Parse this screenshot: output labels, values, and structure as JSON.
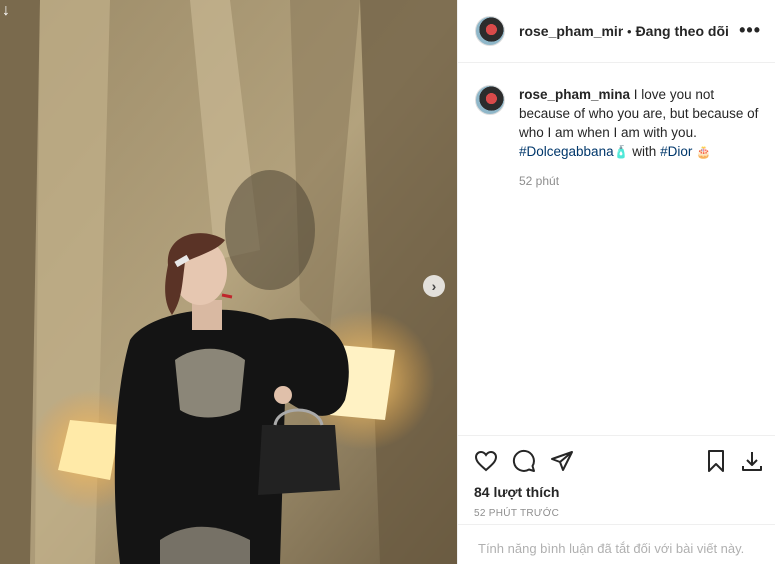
{
  "post": {
    "username": "rose_pham_mina",
    "separator": "•",
    "follow_status": "Đang theo dõi",
    "more_glyph": "•••",
    "caption": {
      "username": "rose_pham_mina",
      "text": " I love you not because of who you are, but because of who I am when I am with you. ",
      "tag1": "#Dolcegabbana",
      "emoji1": "🧴",
      "mid": " with ",
      "tag2": "#Dior",
      "emoji2": "🎂"
    },
    "caption_time": "52 phút",
    "likes": "84 lượt thích",
    "post_time": "52 PHÚT TRƯỚC",
    "comments_disabled": "Tính năng bình luận đã tắt đối với bài viết này.",
    "photo_download_glyph": "↓",
    "next_glyph": "›"
  },
  "icons": [
    "heart-icon",
    "comment-icon",
    "share-icon",
    "bookmark-icon",
    "download-icon"
  ],
  "colors": {
    "hashtag": "#00376b",
    "muted": "#8e8e8e",
    "text": "#262626"
  }
}
